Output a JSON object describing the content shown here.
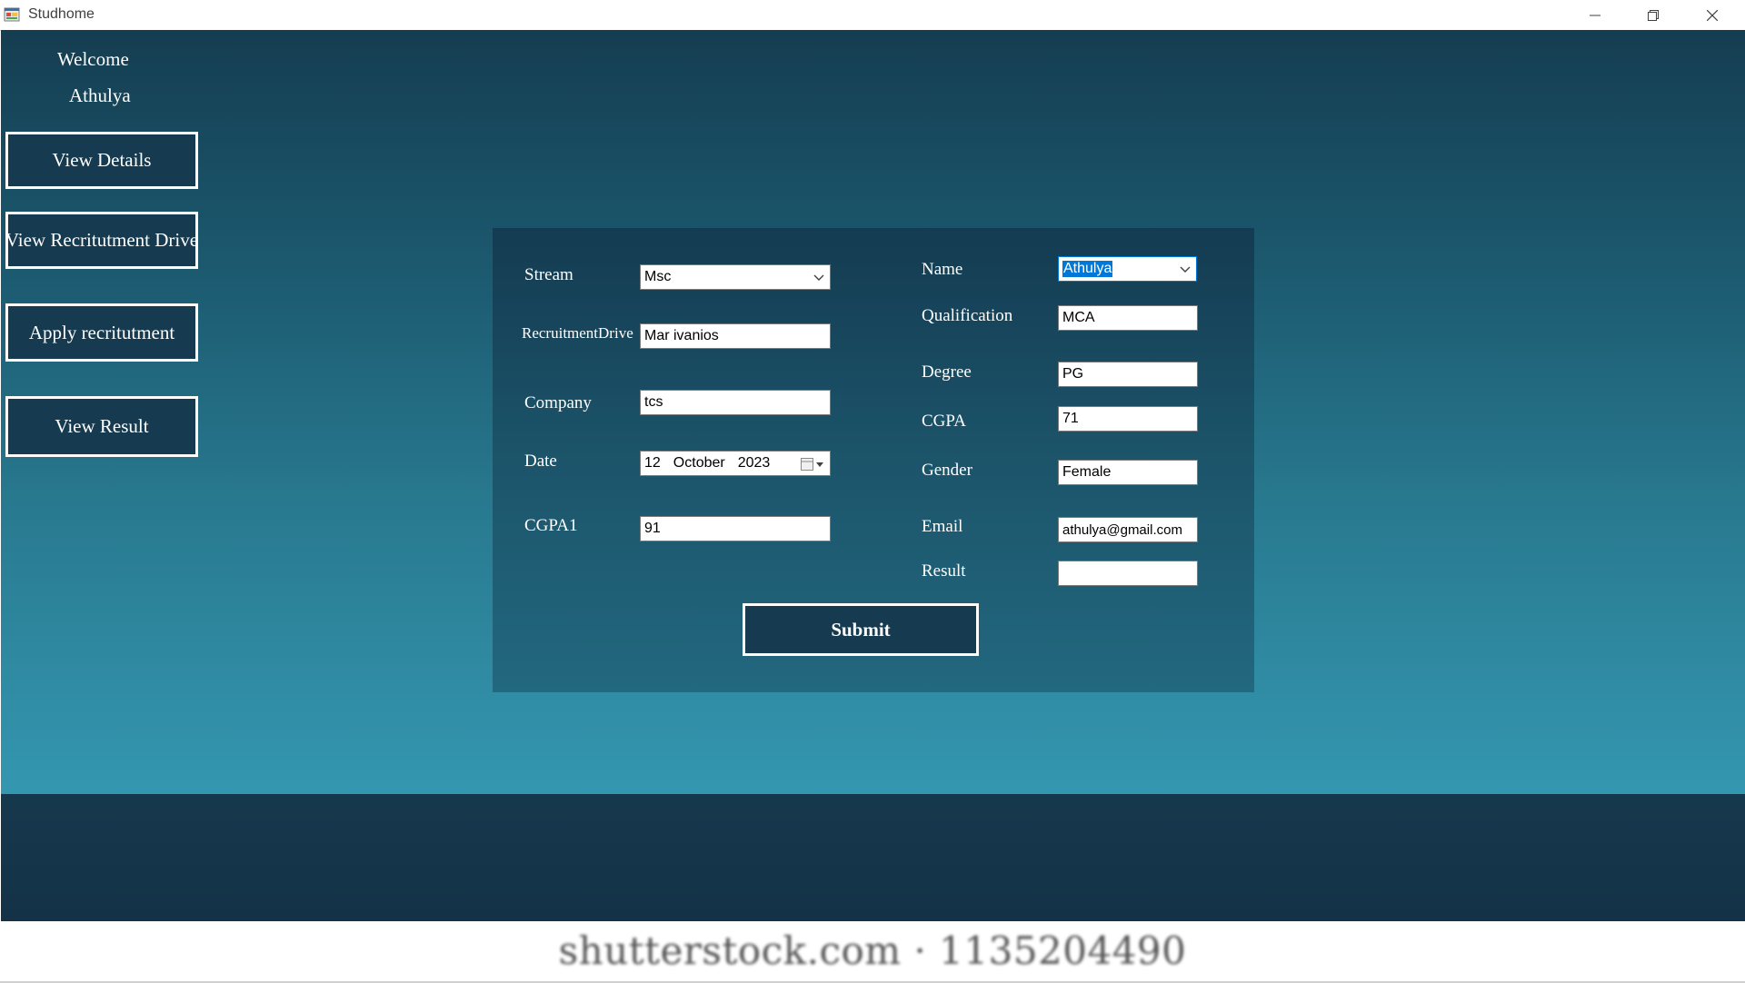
{
  "window": {
    "title": "Studhome"
  },
  "sidebar": {
    "welcome": "Welcome",
    "username": "Athulya",
    "buttons": [
      {
        "label": "View Details"
      },
      {
        "label": "View Recritutment Drive"
      },
      {
        "label": "Apply recritutment"
      },
      {
        "label": "View Result"
      }
    ]
  },
  "form": {
    "stream": {
      "label": "Stream",
      "value": "Msc"
    },
    "drive": {
      "label": "RecruitmentDrive",
      "value": "Mar ivanios"
    },
    "company": {
      "label": "Company",
      "value": "tcs"
    },
    "date": {
      "label": "Date",
      "day": "12",
      "month": "October",
      "year": "2023"
    },
    "cgpa1": {
      "label": "CGPA1",
      "value": "91"
    },
    "name": {
      "label": "Name",
      "value": "Athulya"
    },
    "qualification": {
      "label": "Qualification",
      "value": "MCA"
    },
    "degree": {
      "label": "Degree",
      "value": "PG"
    },
    "cgpa": {
      "label": "CGPA",
      "value": "71"
    },
    "gender": {
      "label": "Gender",
      "value": "Female"
    },
    "email": {
      "label": "Email",
      "value": "athulya@gmail.com"
    },
    "result": {
      "label": "Result",
      "value": ""
    },
    "submit_label": "Submit"
  },
  "watermark": {
    "text": "shutterstock.com · 1135204490"
  },
  "colors": {
    "button_bg": "#163a4f",
    "selection": "#0078d7"
  }
}
